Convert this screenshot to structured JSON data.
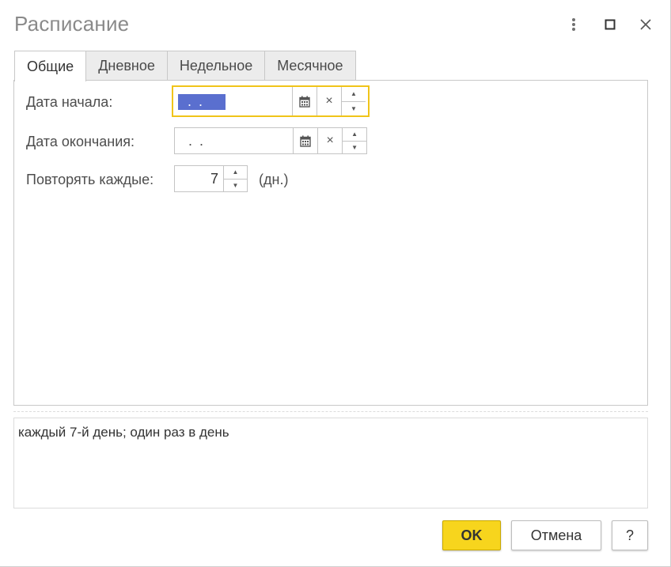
{
  "window": {
    "title": "Расписание"
  },
  "tabs": [
    {
      "label": "Общие",
      "active": true
    },
    {
      "label": "Дневное",
      "active": false
    },
    {
      "label": "Недельное",
      "active": false
    },
    {
      "label": "Месячное",
      "active": false
    }
  ],
  "general": {
    "start_date": {
      "label": "Дата начала:",
      "value": ". ."
    },
    "end_date": {
      "label": "Дата окончания:",
      "value": ". ."
    },
    "repeat": {
      "label": "Повторять каждые:",
      "value": "7",
      "unit": "(дн.)"
    }
  },
  "icons": {
    "calendar": "calendar-icon",
    "clear": "×",
    "up": "▲",
    "down": "▼"
  },
  "description": "каждый 7-й день; один раз в день",
  "buttons": {
    "ok": "OK",
    "cancel": "Отмена",
    "help": "?"
  },
  "colors": {
    "focus_border": "#f0c419",
    "selection": "#5a6fcf",
    "ok_button": "#f7d51d"
  }
}
